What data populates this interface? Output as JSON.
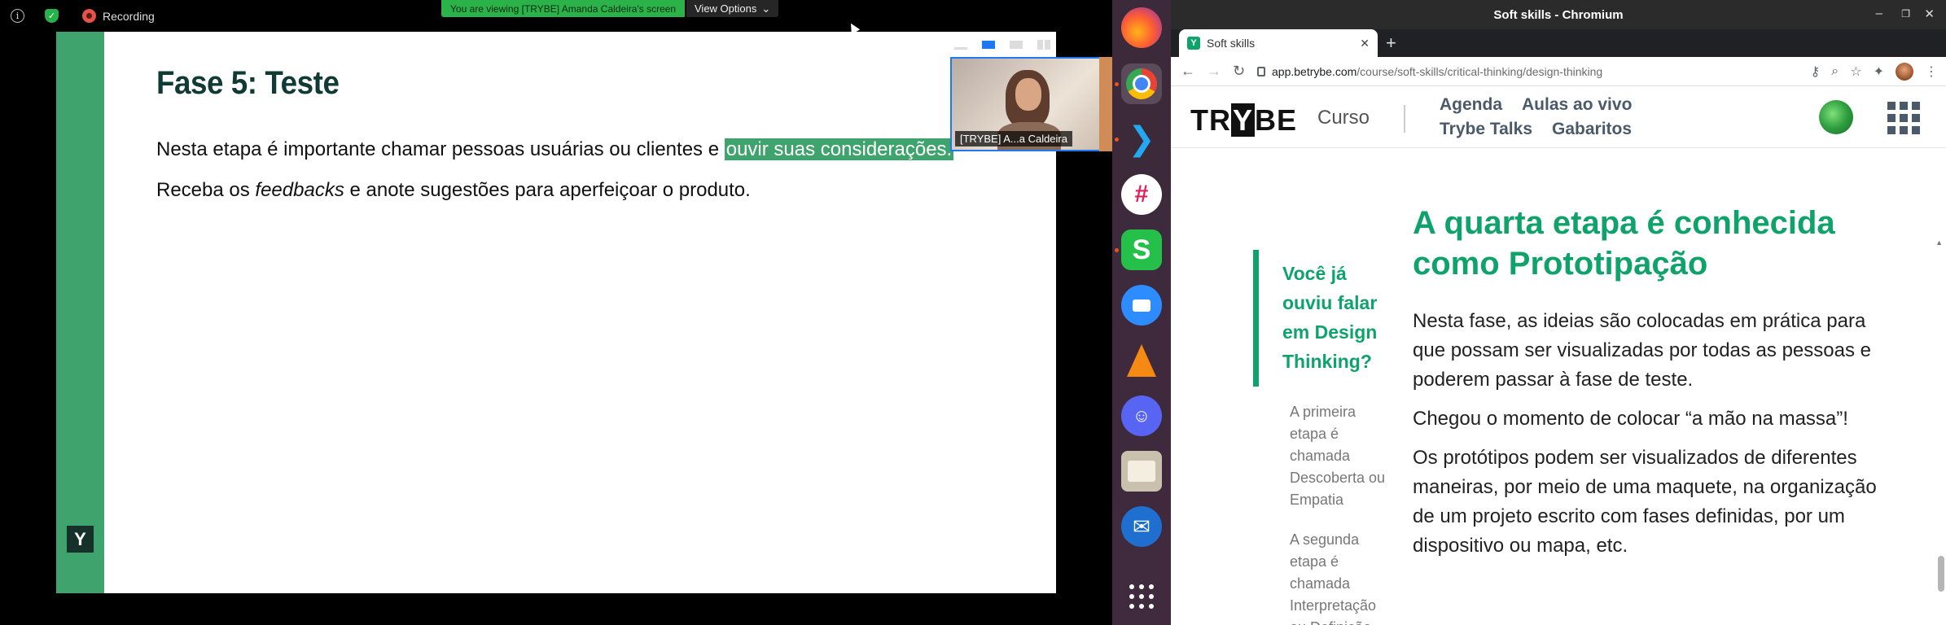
{
  "zoom": {
    "recording_label": "Recording",
    "viewing_banner": "You are viewing [TRYBE] Amanda Caldeira's screen",
    "view_options_label": "View Options",
    "video_name": "[TRYBE] A...a Caldeira",
    "slide": {
      "title": "Fase 5: Teste",
      "p1_before": "Nesta etapa é importante chamar pessoas usuárias ou clientes e ",
      "p1_highlight": "ouvir suas considerações.",
      "p2_before": "Receba os ",
      "p2_em": "feedbacks",
      "p2_after": " e anote sugestões para aperfeiçoar o produto.",
      "logo_letter": "Y"
    },
    "colors": {
      "slide_accent": "#3ea36c",
      "viewing_banner": "#2bb34a"
    }
  },
  "dock": {
    "apps": [
      "firefox-icon",
      "chromium-icon",
      "vscode-icon",
      "slack-icon",
      "spreadsheet-icon",
      "zoom-icon",
      "vlc-icon",
      "discord-icon",
      "files-icon",
      "mail-icon",
      "show-apps-icon"
    ]
  },
  "browser": {
    "window_title": "Soft skills - Chromium",
    "tab_title": "Soft skills",
    "url_host": "app.betrybe.com",
    "url_path": "/course/soft-skills/critical-thinking/design-thinking",
    "site": {
      "logo_before": "TR",
      "logo_y": "Y",
      "logo_after": "BE",
      "section": "Curso",
      "nav": [
        "Agenda",
        "Aulas ao vivo",
        "Trybe Talks",
        "Gabaritos"
      ]
    },
    "toc": {
      "heading": "Você já ouviu falar em Design Thinking?",
      "items": [
        "A primeira etapa é chamada Descoberta ou Empatia",
        "A segunda etapa é chamada Interpretação ou Definição"
      ]
    },
    "article": {
      "heading": "A quarta etapa é conhecida como Prototipação",
      "paragraphs": [
        "Nesta fase, as ideias são colocadas em prática para que possam ser visualizadas por todas as pessoas e poderem passar à fase de teste.",
        "Chegou o momento de colocar “a mão na massa”!",
        "Os protótipos podem ser visualizados de diferentes maneiras, por meio de uma maquete, na organização de um projeto escrito com fases definidas, por um dispositivo ou mapa, etc."
      ]
    },
    "colors": {
      "brand_green": "#0fa36b"
    }
  }
}
